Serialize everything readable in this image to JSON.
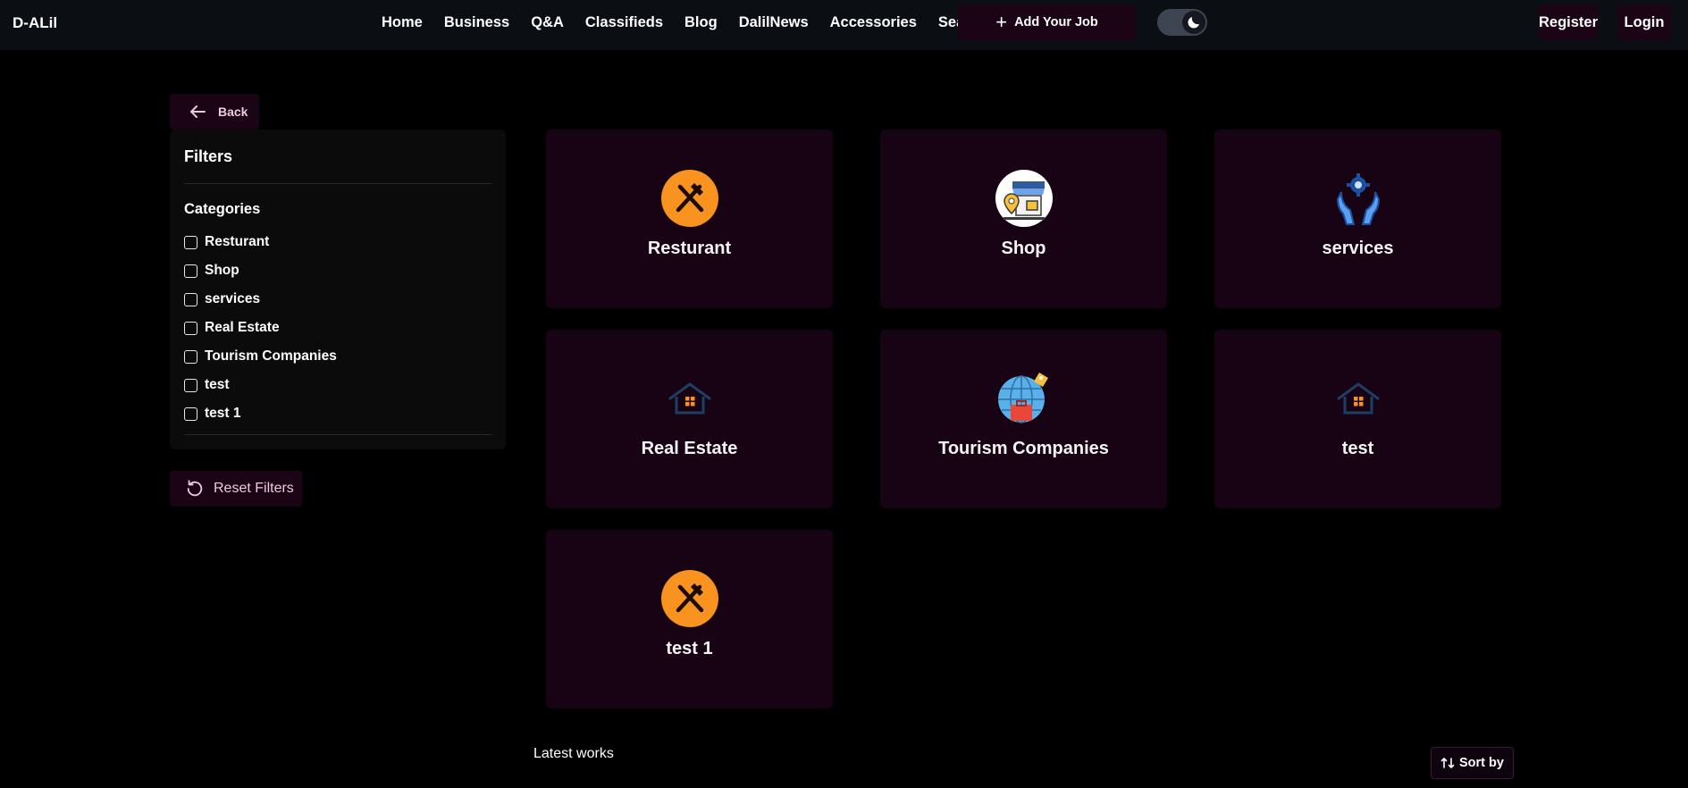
{
  "brand": "D-ALil",
  "nav": {
    "items": [
      "Home",
      "Business",
      "Q&A",
      "Classifieds",
      "Blog",
      "DalilNews",
      "Accessories",
      "Search"
    ],
    "add_job": "Add Your Job",
    "register": "Register",
    "login": "Login"
  },
  "sidebar": {
    "back_label": "Back",
    "filters_title": "Filters",
    "categories_title": "Categories",
    "categories": [
      "Resturant",
      "Shop",
      "services",
      "Real Estate",
      "Tourism Companies",
      "test",
      "test 1"
    ],
    "reset_label": "Reset Filters"
  },
  "cards": [
    {
      "label": "Resturant",
      "icon": "fork-knife-icon"
    },
    {
      "label": "Shop",
      "icon": "shop-icon"
    },
    {
      "label": "services",
      "icon": "gear-hands-icon"
    },
    {
      "label": "Real Estate",
      "icon": "house-icon"
    },
    {
      "label": "Tourism Companies",
      "icon": "globe-suitcase-icon"
    },
    {
      "label": "test",
      "icon": "house-icon"
    },
    {
      "label": "test 1",
      "icon": "fork-knife-icon"
    }
  ],
  "latest_works": "Latest works",
  "sort_label": "Sort by",
  "colors": {
    "accent_bg": "#1a0416",
    "card_bg": "#170314",
    "orange": "#f7931e"
  }
}
